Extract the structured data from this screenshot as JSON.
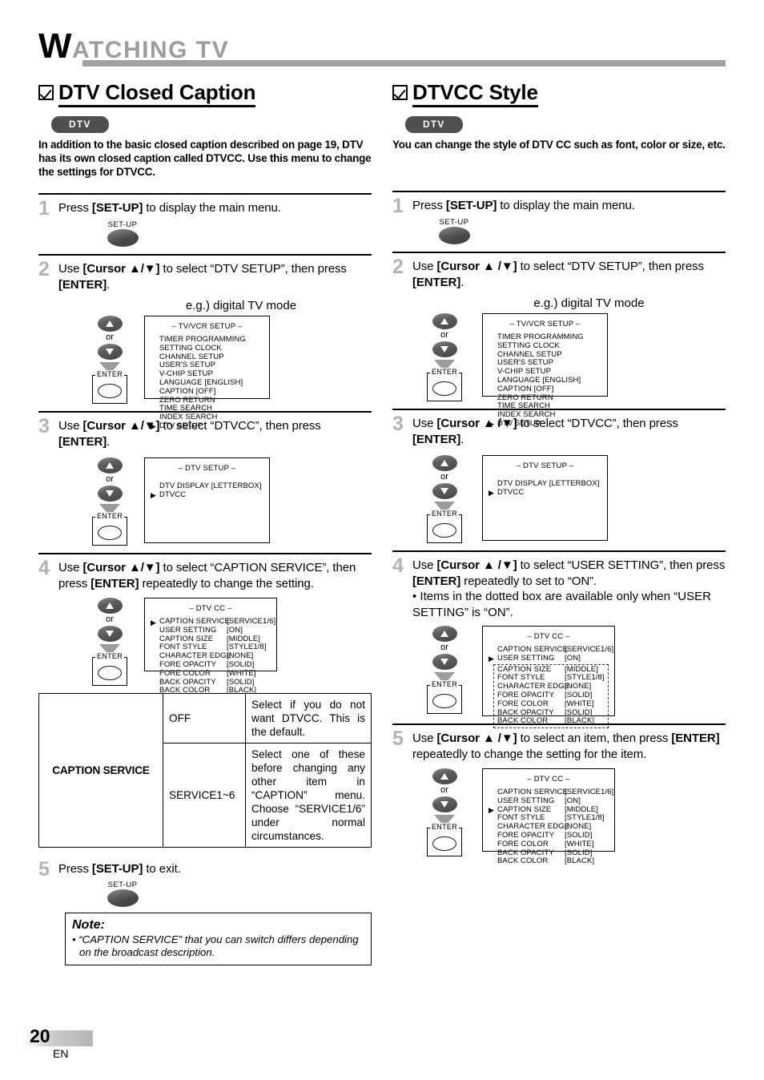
{
  "page_header": {
    "title_cap": "W",
    "title_rest": "ATCHING  TV"
  },
  "footer": {
    "page_number": "20",
    "language_code": "EN"
  },
  "left_column": {
    "section_title": "DTV Closed Caption",
    "badge": "DTV",
    "intro": "In addition to the basic closed caption described on page 19, DTV has its own closed caption called DTVCC. Use this menu to change the settings for DTVCC.",
    "step1": {
      "num": "1",
      "text_a": "Press ",
      "text_b": "[SET-UP]",
      "text_c": " to display the main menu.",
      "button_label": "SET-UP"
    },
    "step2": {
      "num": "2",
      "text_a": "Use ",
      "text_b": "[Cursor ▲/▼]",
      "text_c": " to select “DTV SETUP”, then press ",
      "text_d": "[ENTER]",
      "text_e": ".",
      "or_label": "or",
      "enter_label": "ENTER",
      "eg_label": "e.g.) digital TV mode",
      "menu": {
        "title": "– TV/VCR SETUP –",
        "rows": [
          {
            "cursor": "",
            "key": "TIMER PROGRAMMING",
            "value": ""
          },
          {
            "cursor": "",
            "key": "SETTING CLOCK",
            "value": ""
          },
          {
            "cursor": "",
            "key": "CHANNEL SETUP",
            "value": ""
          },
          {
            "cursor": "",
            "key": "USER'S SETUP",
            "value": ""
          },
          {
            "cursor": "",
            "key": "V-CHIP SETUP",
            "value": ""
          },
          {
            "cursor": "",
            "key": "LANGUAGE  [ENGLISH]",
            "value": ""
          },
          {
            "cursor": "",
            "key": "CAPTION  [OFF]",
            "value": ""
          },
          {
            "cursor": "",
            "key": "ZERO RETURN",
            "value": ""
          },
          {
            "cursor": "",
            "key": "TIME SEARCH",
            "value": ""
          },
          {
            "cursor": "",
            "key": "INDEX SEARCH",
            "value": ""
          },
          {
            "cursor": "▶",
            "key": "DTV SETUP",
            "value": ""
          }
        ]
      }
    },
    "step3": {
      "num": "3",
      "text_a": "Use ",
      "text_b": "[Cursor ▲/▼]",
      "text_c": " to select “DTVCC”, then press ",
      "text_d": "[ENTER]",
      "text_e": ".",
      "or_label": "or",
      "enter_label": "ENTER",
      "menu": {
        "title": "– DTV SETUP –",
        "rows": [
          {
            "cursor": "",
            "key": "DTV DISPLAY   [LETTERBOX]",
            "value": ""
          },
          {
            "cursor": "▶",
            "key": "DTVCC",
            "value": ""
          }
        ]
      }
    },
    "step4": {
      "num": "4",
      "text_a": "Use ",
      "text_b": "[Cursor ▲/▼]",
      "text_c": " to select “CAPTION SERVICE”, then press ",
      "text_d": "[ENTER]",
      "text_e": " repeatedly to change the setting.",
      "or_label": "or",
      "enter_label": "ENTER",
      "menu": {
        "title": "– DTV CC –",
        "rows": [
          {
            "cursor": "▶",
            "key": "CAPTION SERVICE",
            "value": "[SERVICE1/6]"
          },
          {
            "cursor": "",
            "key": "USER SETTING",
            "value": "[ON]"
          },
          {
            "cursor": "",
            "key": "CAPTION SIZE",
            "value": "[MIDDLE]"
          },
          {
            "cursor": "",
            "key": "FONT STYLE",
            "value": "[STYLE1/8]"
          },
          {
            "cursor": "",
            "key": "CHARACTER EDGE",
            "value": "[NONE]"
          },
          {
            "cursor": "",
            "key": "FORE OPACITY",
            "value": "[SOLID]"
          },
          {
            "cursor": "",
            "key": "FORE COLOR",
            "value": "[WHITE]"
          },
          {
            "cursor": "",
            "key": "BACK OPACITY",
            "value": "[SOLID]"
          },
          {
            "cursor": "",
            "key": "BACK COLOR",
            "value": "[BLACK]"
          }
        ]
      }
    },
    "caption_service_table": {
      "name": "CAPTION SERVICE",
      "rows": [
        {
          "value": "OFF",
          "description": "Select if you do not want DTVCC. This is the default."
        },
        {
          "value": "SERVICE1~6",
          "description": "Select one of these before changing any other item in “CAPTION” menu. Choose “SERVICE1/6” under normal circumstances."
        }
      ]
    },
    "step5": {
      "num": "5",
      "text_a": "Press ",
      "text_b": "[SET-UP]",
      "text_c": " to exit.",
      "button_label": "SET-UP"
    },
    "note": {
      "title": "Note:",
      "items": [
        "• “CAPTION SERVICE” that you can switch differs depending on the broadcast description."
      ]
    }
  },
  "right_column": {
    "section_title": "DTVCC Style",
    "badge": "DTV",
    "intro": "You can change the style of DTV CC such as font, color or size, etc.",
    "step1": {
      "num": "1",
      "text_a": "Press ",
      "text_b": "[SET-UP]",
      "text_c": " to display the main menu.",
      "button_label": "SET-UP"
    },
    "step2": {
      "num": "2",
      "text_a": "Use ",
      "text_b": "[Cursor ▲ /▼]",
      "text_c": " to select “DTV SETUP”, then press ",
      "text_d": "[ENTER]",
      "text_e": ".",
      "or_label": "or",
      "enter_label": "ENTER",
      "eg_label": "e.g.) digital TV mode",
      "menu": {
        "title": "– TV/VCR SETUP –",
        "rows": [
          {
            "cursor": "",
            "key": "TIMER PROGRAMMING",
            "value": ""
          },
          {
            "cursor": "",
            "key": "SETTING CLOCK",
            "value": ""
          },
          {
            "cursor": "",
            "key": "CHANNEL SETUP",
            "value": ""
          },
          {
            "cursor": "",
            "key": "USER'S SETUP",
            "value": ""
          },
          {
            "cursor": "",
            "key": "V-CHIP SETUP",
            "value": ""
          },
          {
            "cursor": "",
            "key": "LANGUAGE  [ENGLISH]",
            "value": ""
          },
          {
            "cursor": "",
            "key": "CAPTION  [OFF]",
            "value": ""
          },
          {
            "cursor": "",
            "key": "ZERO RETURN",
            "value": ""
          },
          {
            "cursor": "",
            "key": "TIME SEARCH",
            "value": ""
          },
          {
            "cursor": "",
            "key": "INDEX SEARCH",
            "value": ""
          },
          {
            "cursor": "▶",
            "key": "DTV SETUP",
            "value": ""
          }
        ]
      }
    },
    "step3": {
      "num": "3",
      "text_a": "Use ",
      "text_b": "[Cursor ▲ /▼]",
      "text_c": " to select “DTVCC”, then press ",
      "text_d": "[ENTER]",
      "text_e": ".",
      "or_label": "or",
      "enter_label": "ENTER",
      "menu": {
        "title": "– DTV SETUP –",
        "rows": [
          {
            "cursor": "",
            "key": "DTV DISPLAY   [LETTERBOX]",
            "value": ""
          },
          {
            "cursor": "▶",
            "key": "DTVCC",
            "value": ""
          }
        ]
      }
    },
    "step4": {
      "num": "4",
      "text_a": "Use ",
      "text_b": "[Cursor ▲ /▼]",
      "text_c": " to select “USER SETTING”, then press ",
      "text_d": "[ENTER]",
      "text_e": " repeatedly to set to “ON”.",
      "bullet": "• Items in the dotted box are available only when “USER SETTING” is “ON”.",
      "or_label": "or",
      "enter_label": "ENTER",
      "menu": {
        "title": "– DTV CC –",
        "rows_top": [
          {
            "cursor": "",
            "key": "CAPTION SERVICE",
            "value": "[SERVICE1/6]"
          },
          {
            "cursor": "▶",
            "key": "USER SETTING",
            "value": "[ON]"
          }
        ],
        "rows_dotted": [
          {
            "cursor": "",
            "key": "CAPTION SIZE",
            "value": "[MIDDLE]"
          },
          {
            "cursor": "",
            "key": "FONT STYLE",
            "value": "[STYLE1/8]"
          },
          {
            "cursor": "",
            "key": "CHARACTER EDGE",
            "value": "[NONE]"
          },
          {
            "cursor": "",
            "key": "FORE OPACITY",
            "value": "[SOLID]"
          },
          {
            "cursor": "",
            "key": "FORE COLOR",
            "value": "[WHITE]"
          },
          {
            "cursor": "",
            "key": "BACK OPACITY",
            "value": "[SOLID]"
          },
          {
            "cursor": "",
            "key": "BACK COLOR",
            "value": "[BLACK]"
          }
        ]
      }
    },
    "step5": {
      "num": "5",
      "text_a": "Use ",
      "text_b": "[Cursor ▲ /▼]",
      "text_c": " to select an item, then press ",
      "text_d": "[ENTER]",
      "text_e": " repeatedly to change the setting for the item.",
      "or_label": "or",
      "enter_label": "ENTER",
      "menu": {
        "title": "– DTV CC –",
        "rows": [
          {
            "cursor": "",
            "key": "CAPTION SERVICE",
            "value": "[SERVICE1/6]"
          },
          {
            "cursor": "",
            "key": "USER SETTING",
            "value": "[ON]"
          },
          {
            "cursor": "▶",
            "key": "CAPTION SIZE",
            "value": "[MIDDLE]"
          },
          {
            "cursor": "",
            "key": "FONT STYLE",
            "value": "[STYLE1/8]"
          },
          {
            "cursor": "",
            "key": "CHARACTER EDGE",
            "value": "[NONE]"
          },
          {
            "cursor": "",
            "key": "FORE OPACITY",
            "value": "[SOLID]"
          },
          {
            "cursor": "",
            "key": "FORE COLOR",
            "value": "[WHITE]"
          },
          {
            "cursor": "",
            "key": "BACK OPACITY",
            "value": "[SOLID]"
          },
          {
            "cursor": "",
            "key": "BACK COLOR",
            "value": "[BLACK]"
          }
        ]
      }
    }
  }
}
